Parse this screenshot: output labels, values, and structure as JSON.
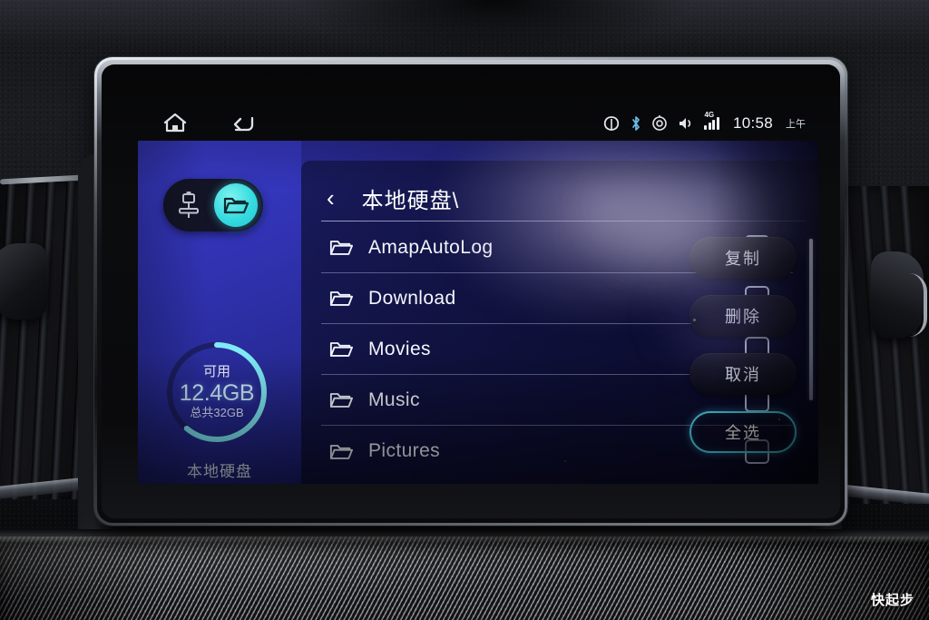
{
  "device": {
    "type": "car-infotainment-head-unit",
    "watermark": "快起步"
  },
  "navbar": {
    "home_icon": "home-icon",
    "back_icon": "back-arrow-icon"
  },
  "statusbar": {
    "icons": [
      "eco-leaf-icon",
      "bluetooth-icon",
      "location-icon",
      "volume-icon",
      "signal-4g-icon"
    ],
    "network_label": "4G",
    "time": "10:58",
    "ampm": "上午"
  },
  "source_toggle": {
    "usb_label": "usb-icon",
    "folder_label": "folder-icon",
    "active": "folder",
    "active_color": "#36dbe0"
  },
  "storage": {
    "available_label": "可用",
    "available_value": "12.4GB",
    "total_label": "总共32GB",
    "device_label": "本地硬盘",
    "used_percent": 61,
    "arc_color": "#7fe9f5",
    "track_color": "#1b1c5e"
  },
  "breadcrumb": {
    "back_glyph": "‹",
    "path": "本地硬盘\\"
  },
  "files": [
    {
      "name": "AmapAutoLog",
      "icon": "folder-icon",
      "checked": false
    },
    {
      "name": "Download",
      "icon": "folder-icon",
      "checked": false
    },
    {
      "name": "Movies",
      "icon": "folder-icon",
      "checked": false
    },
    {
      "name": "Music",
      "icon": "folder-icon",
      "checked": false
    },
    {
      "name": "Pictures",
      "icon": "folder-icon",
      "checked": false
    }
  ],
  "actions": [
    {
      "label": "复制",
      "style": "filled",
      "name": "copy-button"
    },
    {
      "label": "删除",
      "style": "filled",
      "name": "delete-button"
    },
    {
      "label": "取消",
      "style": "filled",
      "name": "cancel-button"
    },
    {
      "label": "全选",
      "style": "outline",
      "name": "select-all-button"
    }
  ],
  "theme": {
    "screen_blue": "#2b2c9e",
    "panel_dark": "#121447",
    "accent_cyan": "#4fd8f0",
    "text_primary": "#f4f6fc"
  }
}
